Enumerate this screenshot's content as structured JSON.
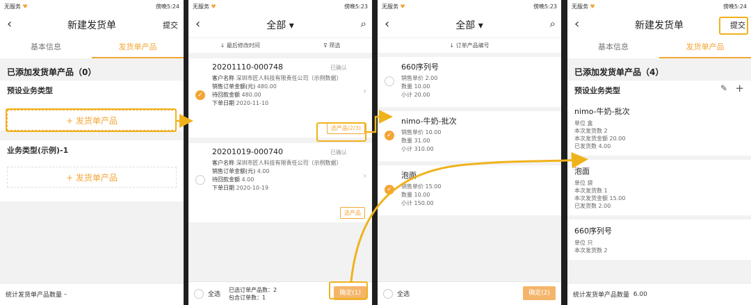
{
  "status": {
    "carrier": "无服务",
    "time_a": "傍晚5:24",
    "time_b": "傍晚5:23",
    "time_c": "傍晚5:23",
    "time_d": "傍晚5:24"
  },
  "screen1": {
    "title": "新建发货单",
    "submit": "提交",
    "tab_basic": "基本信息",
    "tab_products": "发货单产品",
    "added_title": "已添加发货单产品（0）",
    "preset_type": "预设业务类型",
    "add_product": "+ 发货单产品",
    "biz_type": "业务类型(示例)-1",
    "add_product2": "+ 发货单产品",
    "footer_label": "统计发货单产品数量",
    "footer_value": "–"
  },
  "screen2": {
    "title": "全部 ▾",
    "sort_label": "↓ 最后修改时间",
    "filter_label": "筛选",
    "orders": [
      {
        "id": "20201110-000748",
        "status": "已确认",
        "customer_label": "客户名称",
        "customer": "深圳市匠人科技有限责任公司（示例数据）",
        "amount_label": "销售订单金额(元)",
        "amount": "480.00",
        "pending_label": "待回款金额",
        "pending": "480.00",
        "date_label": "下单日期",
        "date": "2020-11-10",
        "pick": "选产品(2/3)"
      },
      {
        "id": "20201019-000740",
        "status": "已确认",
        "customer_label": "客户名称",
        "customer": "深圳市匠人科技有限责任公司（示例数据）",
        "amount_label": "销售订单金额(元)",
        "amount": "4.00",
        "pending_label": "待回款金额",
        "pending": "4.00",
        "date_label": "下单日期",
        "date": "2020-10-19",
        "pick": "选产品"
      }
    ],
    "select_all": "全选",
    "selected_products": "已选订单产品数：2",
    "selected_orders": "包含订单数：1",
    "confirm": "确定(1)"
  },
  "screen3": {
    "title": "全部 ▾",
    "sort_label": "↓ 订单产品编号",
    "products": [
      {
        "name": "660序列号",
        "price": "销售单价 2.00",
        "qty": "数量 10.00",
        "subtotal": "小计 20.00",
        "checked": false
      },
      {
        "name": "nimo-牛奶-批次",
        "price": "销售单价 10.00",
        "qty": "数量 31.00",
        "subtotal": "小计 310.00",
        "checked": true
      },
      {
        "name": "泡面",
        "price": "销售单价 15.00",
        "qty": "数量 10.00",
        "subtotal": "小计 150.00",
        "checked": true
      }
    ],
    "select_all": "全选",
    "confirm": "确定(2)"
  },
  "screen4": {
    "title": "新建发货单",
    "submit": "提交",
    "tab_basic": "基本信息",
    "tab_products": "发货单产品",
    "added_title": "已添加发货单产品（4）",
    "preset_type": "预设业务类型",
    "items": [
      {
        "name": "nimo-牛奶-批次",
        "unit": "单位 盒",
        "ship_qty": "本次发货数 2",
        "ship_amount": "本次发货金额 20.00",
        "shipped": "已发货数 4.00"
      },
      {
        "name": "泡面",
        "unit": "单位 袋",
        "ship_qty": "本次发货数 1",
        "ship_amount": "本次发货金额 15.00",
        "shipped": "已发货数 2.00"
      },
      {
        "name": "660序列号",
        "unit": "单位 只",
        "ship_qty": "本次发货数 2",
        "ship_amount": "",
        "shipped": ""
      }
    ],
    "footer_label": "统计发货单产品数量",
    "footer_value": "6.00"
  },
  "colors": {
    "accent": "#f4a535",
    "highlight": "#f0b21b"
  }
}
